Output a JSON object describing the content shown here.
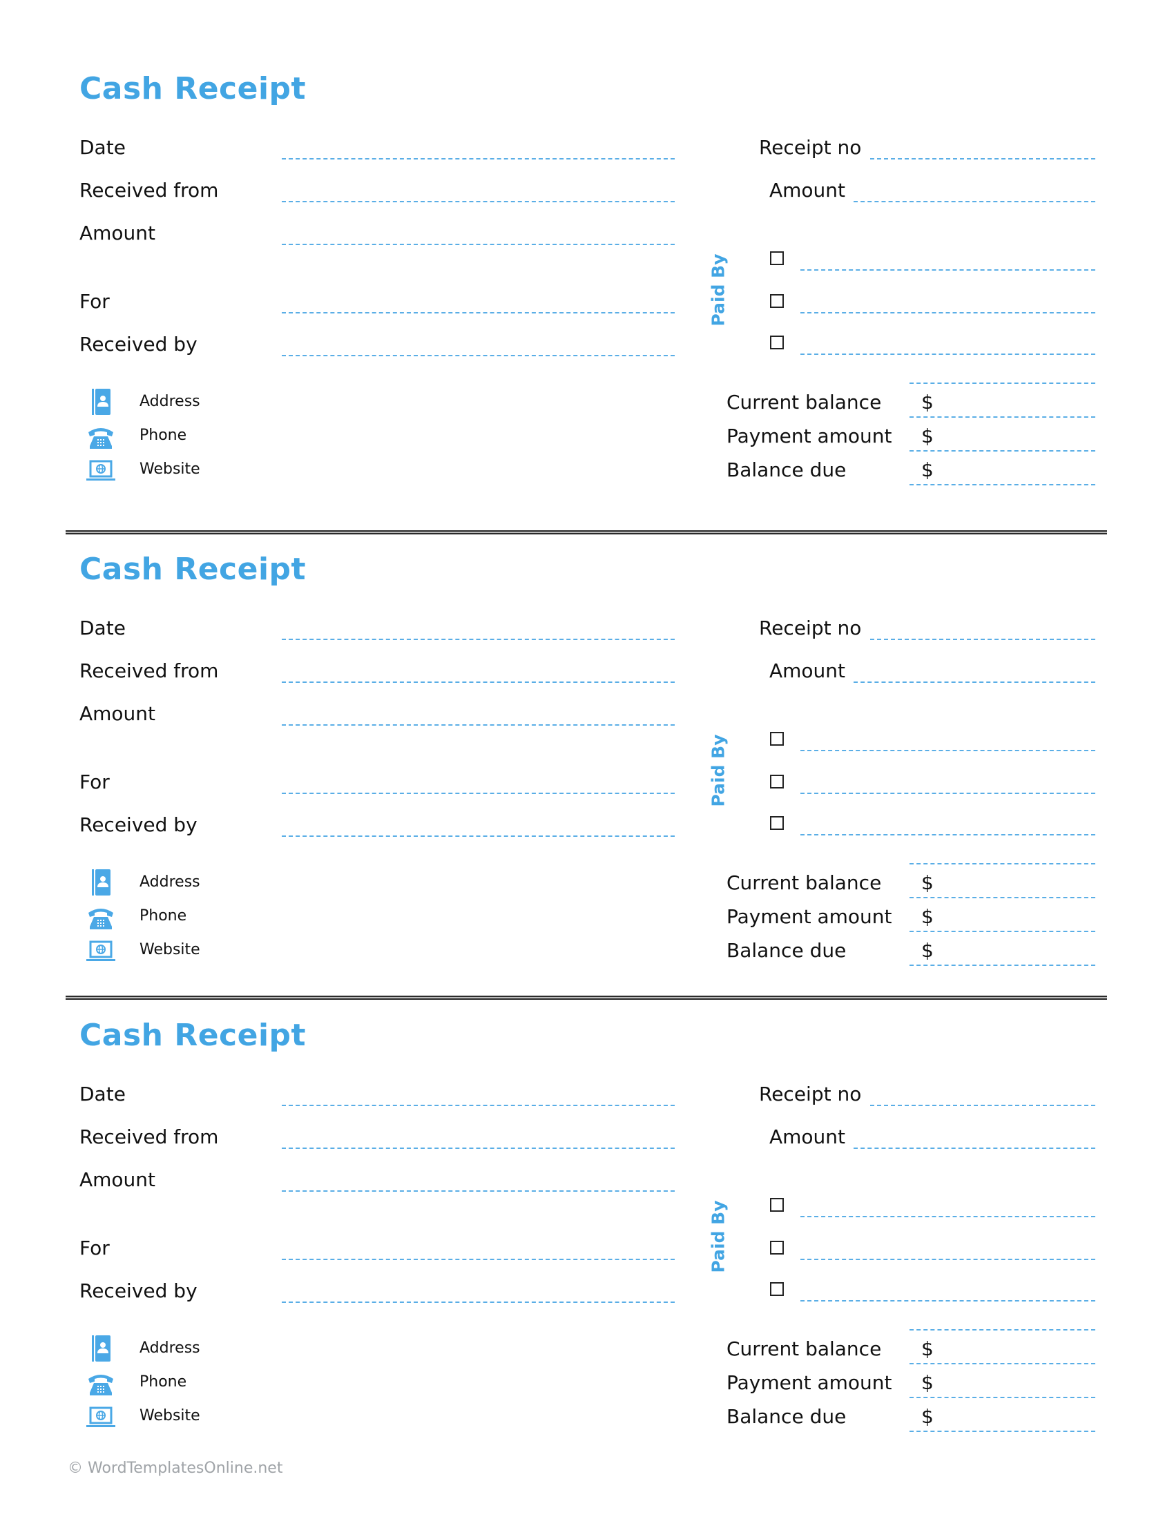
{
  "colors": {
    "accent": "#42a5e3",
    "line": "#5aaee6",
    "footer": "#a0a4a8"
  },
  "receipts": [
    {
      "title": "Cash Receipt",
      "left_fields": [
        "Date",
        "Received from",
        "Amount",
        "For",
        "Received by"
      ],
      "receipt_no_label": "Receipt no",
      "amount_label": "Amount",
      "paid_by_label": "Paid By",
      "paid_by_options": [
        "",
        "",
        ""
      ],
      "contact": [
        {
          "icon": "address-book-icon",
          "label": "Address"
        },
        {
          "icon": "phone-icon",
          "label": "Phone"
        },
        {
          "icon": "laptop-globe-icon",
          "label": "Website"
        }
      ],
      "balance": [
        {
          "label": "Current balance",
          "currency": "$",
          "value": ""
        },
        {
          "label": "Payment amount",
          "currency": "$",
          "value": ""
        },
        {
          "label": "Balance due",
          "currency": "$",
          "value": ""
        }
      ]
    },
    {
      "title": "Cash Receipt",
      "left_fields": [
        "Date",
        "Received from",
        "Amount",
        "For",
        "Received by"
      ],
      "receipt_no_label": "Receipt no",
      "amount_label": "Amount",
      "paid_by_label": "Paid By",
      "paid_by_options": [
        "",
        "",
        ""
      ],
      "contact": [
        {
          "icon": "address-book-icon",
          "label": "Address"
        },
        {
          "icon": "phone-icon",
          "label": "Phone"
        },
        {
          "icon": "laptop-globe-icon",
          "label": "Website"
        }
      ],
      "balance": [
        {
          "label": "Current balance",
          "currency": "$",
          "value": ""
        },
        {
          "label": "Payment amount",
          "currency": "$",
          "value": ""
        },
        {
          "label": "Balance due",
          "currency": "$",
          "value": ""
        }
      ]
    },
    {
      "title": "Cash Receipt",
      "left_fields": [
        "Date",
        "Received from",
        "Amount",
        "For",
        "Received by"
      ],
      "receipt_no_label": "Receipt no",
      "amount_label": "Amount",
      "paid_by_label": "Paid By",
      "paid_by_options": [
        "",
        "",
        ""
      ],
      "contact": [
        {
          "icon": "address-book-icon",
          "label": "Address"
        },
        {
          "icon": "phone-icon",
          "label": "Phone"
        },
        {
          "icon": "laptop-globe-icon",
          "label": "Website"
        }
      ],
      "balance": [
        {
          "label": "Current balance",
          "currency": "$",
          "value": ""
        },
        {
          "label": "Payment amount",
          "currency": "$",
          "value": ""
        },
        {
          "label": "Balance due",
          "currency": "$",
          "value": ""
        }
      ]
    }
  ],
  "footer": "© WordTemplatesOnline.net"
}
